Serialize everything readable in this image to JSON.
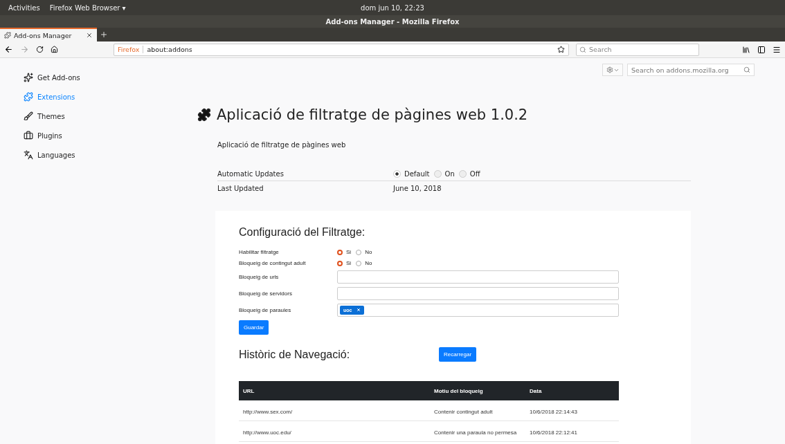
{
  "top_bar": {
    "activities": "Activities",
    "app_menu": "Firefox Web Browser ▾",
    "clock": "dom jun 10, 22:23"
  },
  "window": {
    "title": "Add-ons Manager - Mozilla Firefox"
  },
  "tabs": [
    {
      "label": "Add-ons Manager",
      "selected": true
    }
  ],
  "nav": {
    "identity": "Firefox",
    "url": "about:addons",
    "search_placeholder": "Search"
  },
  "sidebar": {
    "items": [
      {
        "label": "Get Add-ons",
        "kind": "get",
        "selected": false
      },
      {
        "label": "Extensions",
        "kind": "extensions",
        "selected": true
      },
      {
        "label": "Themes",
        "kind": "themes",
        "selected": false
      },
      {
        "label": "Plugins",
        "kind": "plugins",
        "selected": false
      },
      {
        "label": "Languages",
        "kind": "languages",
        "selected": false
      }
    ]
  },
  "addon_search": {
    "placeholder": "Search on addons.mozilla.org"
  },
  "addon": {
    "title": "Aplicació de filtratge de pàgines web 1.0.2",
    "description": "Aplicació de filtratge de pàgines web",
    "details": [
      {
        "label": "Automatic Updates",
        "kind": "radios",
        "options": [
          {
            "label": "Default",
            "selected": true
          },
          {
            "label": "On",
            "selected": false
          },
          {
            "label": "Off",
            "selected": false
          }
        ]
      },
      {
        "label": "Last Updated",
        "kind": "text",
        "value": "June 10, 2018"
      }
    ]
  },
  "config": {
    "heading": "Configuració del Filtratge:",
    "rows": [
      {
        "label": "Habilitar filtratge",
        "kind": "radios",
        "options": [
          {
            "label": "Si",
            "selected": true
          },
          {
            "label": "No",
            "selected": false
          }
        ]
      },
      {
        "label": "Bloqueig de contingut adult",
        "kind": "radios",
        "options": [
          {
            "label": "Si",
            "selected": true
          },
          {
            "label": "No",
            "selected": false
          }
        ]
      },
      {
        "label": "Bloqueig de urls",
        "kind": "input"
      },
      {
        "label": "Bloqueig de servidors",
        "kind": "input"
      },
      {
        "label": "Bloqueig de paraules",
        "kind": "tags",
        "tags": [
          "uoc"
        ]
      }
    ],
    "save": "Guardar"
  },
  "history": {
    "heading": "Històric de Navegació:",
    "reload": "Recarregar",
    "table": {
      "columns": [
        "URL",
        "Motiu del bloqueig",
        "Data"
      ],
      "rows": [
        [
          "http://www.sex.com/",
          "Contenir contingut adult",
          "10/6/2018 22:14:43"
        ],
        [
          "http://www.uoc.edu/",
          "Contenir una paraula no permesa",
          "10/6/2018 22:12:41"
        ]
      ]
    }
  }
}
